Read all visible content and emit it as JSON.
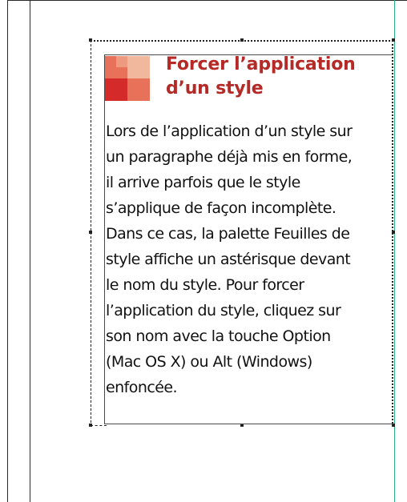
{
  "sidebar_box": {
    "title": "Forcer l’application\nd’un style",
    "body": "Lors de l’application d’un style sur\nun paragraphe déjà mis en forme,\nil arrive parfois que le style\ns’applique de façon incomplète.\nDans ce cas, la palette Feuilles de\nstyle affiche un astérisque devant\nle nom du style. Pour forcer\nl’application du style, cliquez sur\nson nom avec la touche Option\n(Mac OS X) ou Alt (Windows)\nenfoncée."
  },
  "colors": {
    "title": "#b52a26",
    "icon_light": "#f2b89e",
    "icon_mid": "#e8715a",
    "icon_dark": "#d42a2a",
    "column_guide": "#29b37a"
  },
  "icons": {
    "title_marker": "red-squares-icon"
  }
}
